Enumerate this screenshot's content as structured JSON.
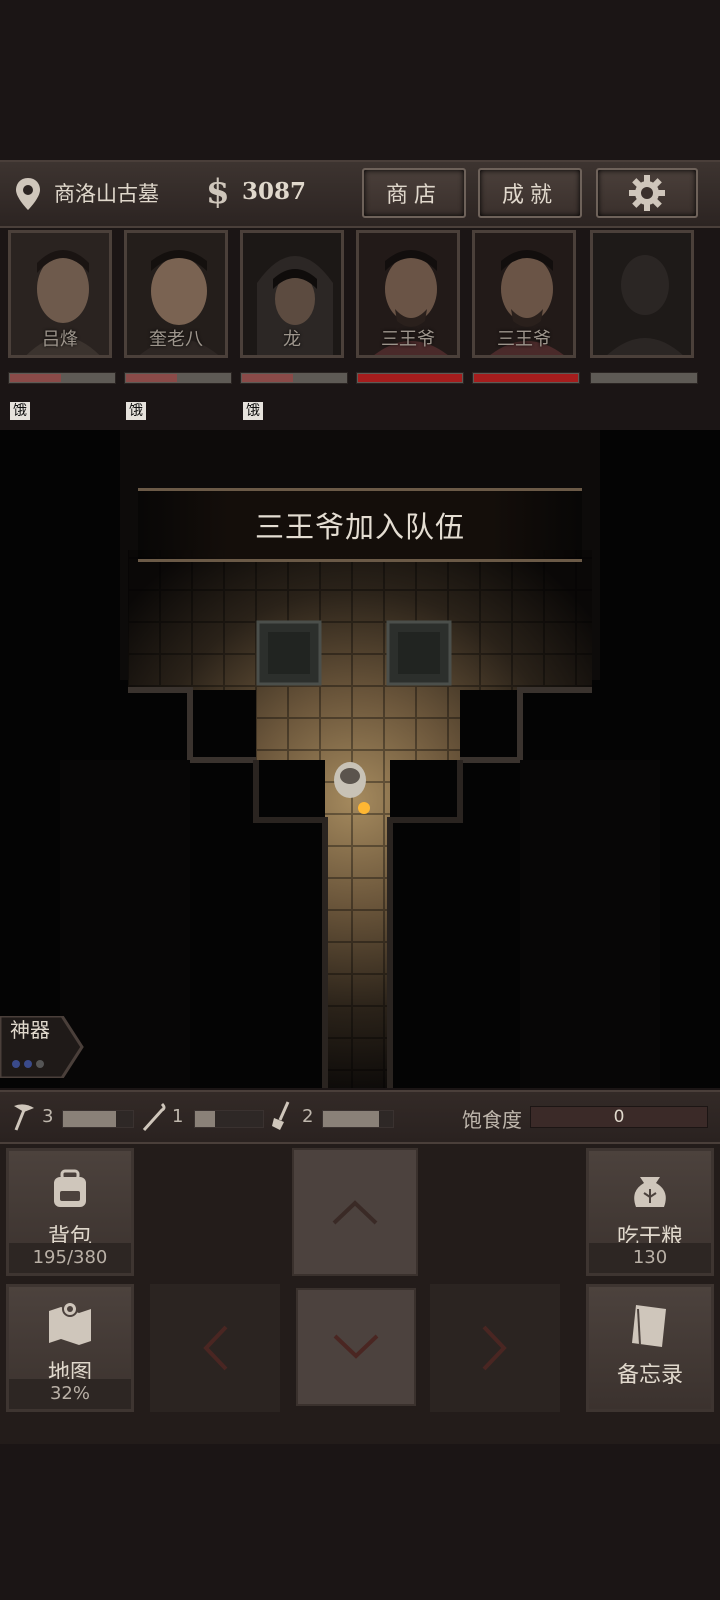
{
  "location": {
    "name": "商洛山古墓"
  },
  "money": {
    "symbol": "$",
    "amount": "3087"
  },
  "buttons": {
    "shop": "商店",
    "achievements": "成就",
    "settings_icon": "gear-icon"
  },
  "party": [
    {
      "name": "吕烽",
      "status": "饿",
      "health_fraction": 0.5,
      "bar_color": "#8a4a48"
    },
    {
      "name": "奎老八",
      "status": "饿",
      "health_fraction": 0.5,
      "bar_color": "#8a4a48"
    },
    {
      "name": "龙",
      "status": "饿",
      "health_fraction": 0.5,
      "bar_color": "#8a4a48"
    },
    {
      "name": "三王爷",
      "status": "",
      "health_fraction": 1.0,
      "bar_color": "#a51d1d"
    },
    {
      "name": "三王爷",
      "status": "",
      "health_fraction": 1.0,
      "bar_color": "#a51d1d"
    },
    {
      "name": "",
      "status": "",
      "health_fraction": 0,
      "bar_color": "#5e5a55"
    }
  ],
  "message": "三王爷加入队伍",
  "artifact": {
    "label": "神器"
  },
  "tools": [
    {
      "icon": "pickaxe-icon",
      "count": "3",
      "fraction": 0.75
    },
    {
      "icon": "crowbar-icon",
      "count": "1",
      "fraction": 0.3
    },
    {
      "icon": "shovel-icon",
      "count": "2",
      "fraction": 0.8
    }
  ],
  "satiety": {
    "label": "饱食度",
    "value": "0"
  },
  "panels": {
    "backpack": {
      "label": "背包",
      "sub": "195/380"
    },
    "food": {
      "label": "吃干粮",
      "sub": "130"
    },
    "map": {
      "label": "地图",
      "sub": "32%"
    },
    "memo": {
      "label": "备忘录"
    }
  }
}
